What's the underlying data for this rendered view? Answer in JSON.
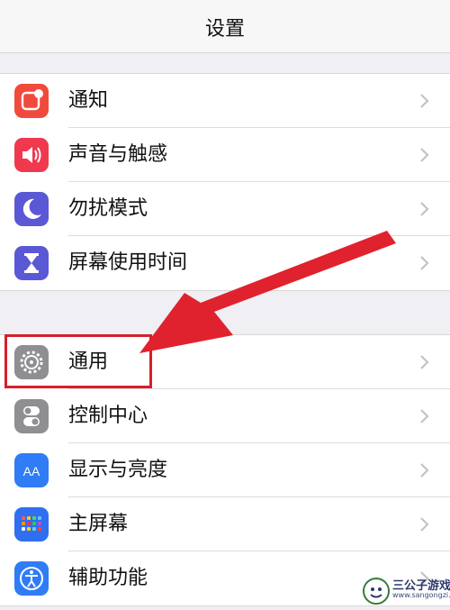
{
  "nav": {
    "title": "设置"
  },
  "group1": [
    {
      "id": "notifications",
      "label": "通知",
      "icon": "notifications-icon",
      "color": "#f14a3c"
    },
    {
      "id": "sounds",
      "label": "声音与触感",
      "icon": "speaker-icon",
      "color": "#f0394f"
    },
    {
      "id": "dnd",
      "label": "勿扰模式",
      "icon": "moon-icon",
      "color": "#5b58d6"
    },
    {
      "id": "screen-time",
      "label": "屏幕使用时间",
      "icon": "hourglass-icon",
      "color": "#5b58d6"
    }
  ],
  "group2": [
    {
      "id": "general",
      "label": "通用",
      "icon": "gear-icon",
      "color": "#8e8e93"
    },
    {
      "id": "control-center",
      "label": "控制中心",
      "icon": "toggles-icon",
      "color": "#8e8e93"
    },
    {
      "id": "display",
      "label": "显示与亮度",
      "icon": "aa-icon",
      "color": "#2f7cf6"
    },
    {
      "id": "home-screen",
      "label": "主屏幕",
      "icon": "home-grid-icon",
      "color": "#2f6ff0"
    },
    {
      "id": "accessibility",
      "label": "辅助功能",
      "icon": "accessibility-icon",
      "color": "#2f7cf6"
    }
  ],
  "annotation": {
    "color": "#d61f2c",
    "highlight_target": "通用"
  },
  "watermark": {
    "name": "三公子游戏网",
    "url": "www.sangongzi.net"
  }
}
